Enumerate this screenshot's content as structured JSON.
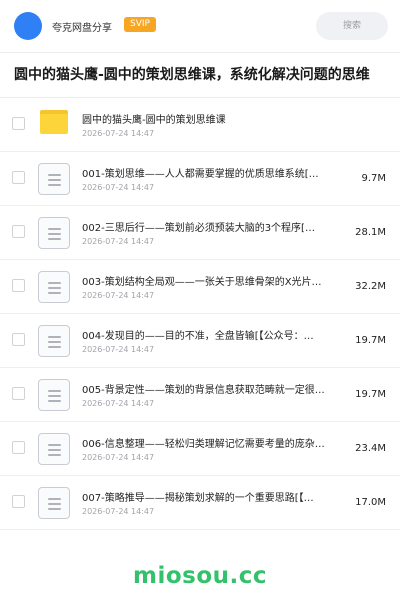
{
  "header": {
    "app_name": "夸克网盘分享",
    "badge": "SVIP",
    "search_placeholder": "搜索"
  },
  "page_title": "圆中的猫头鹰-圆中的策划思维课，系统化解决问题的思维",
  "items": [
    {
      "type": "folder",
      "name": "圆中的猫头鹰-圆中的策划思维课",
      "date": "2026-07-24 14:47",
      "size": ""
    },
    {
      "type": "file",
      "name": "001-策划思维——人人都需要掌握的优质思维系统[…",
      "date": "2026-07-24 14:47",
      "size": "9.7M"
    },
    {
      "type": "file",
      "name": "002-三思后行——策划前必须预装大脑的3个程序[…",
      "date": "2026-07-24 14:47",
      "size": "28.1M"
    },
    {
      "type": "file",
      "name": "003-策划结构全局观——一张关于思维骨架的X光片…",
      "date": "2026-07-24 14:47",
      "size": "32.2M"
    },
    {
      "type": "file",
      "name": "004-发现目的——目的不准，全盘皆输[【公众号：…",
      "date": "2026-07-24 14:47",
      "size": "19.7M"
    },
    {
      "type": "file",
      "name": "005-背景定性——策划的背景信息获取范畴就一定很…",
      "date": "2026-07-24 14:47",
      "size": "19.7M"
    },
    {
      "type": "file",
      "name": "006-信息整理——轻松归类理解记忆需要考量的庞杂…",
      "date": "2026-07-24 14:47",
      "size": "23.4M"
    },
    {
      "type": "file",
      "name": "007-策略推导——揭秘策划求解的一个重要思路[【…",
      "date": "2026-07-24 14:47",
      "size": "17.0M"
    }
  ],
  "watermark": "miosou.cc",
  "colors": {
    "accent": "#2f80f4",
    "badge": "#f6a623",
    "folder": "#fcd53a",
    "watermark": "#33c16b"
  }
}
